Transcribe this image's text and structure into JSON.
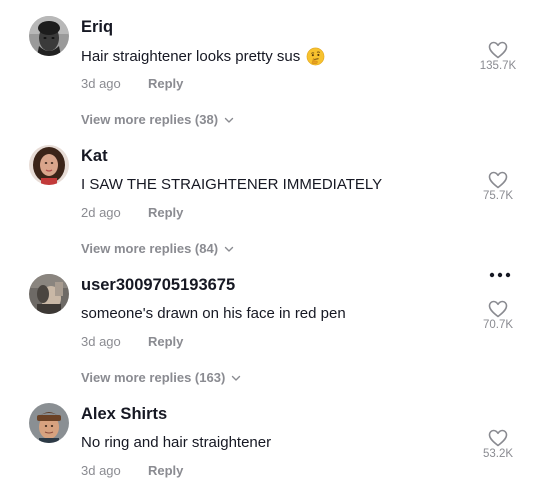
{
  "comments": [
    {
      "username": "Eriq",
      "text": "Hair straightener looks pretty sus",
      "emoji": "thinking-face-emoji",
      "age": "3d ago",
      "reply_label": "Reply",
      "likes": "135.7K",
      "view_more": "View more replies (38)"
    },
    {
      "username": "Kat",
      "text": "I SAW THE STRAIGHTENER IMMEDIATELY",
      "age": "2d ago",
      "reply_label": "Reply",
      "likes": "75.7K",
      "view_more": "View more replies (84)"
    },
    {
      "username": "user3009705193675",
      "text": "someone's drawn on his face in red pen",
      "age": "3d ago",
      "reply_label": "Reply",
      "likes": "70.7K",
      "view_more": "View more replies (163)",
      "more_icon": "ellipsis-icon"
    },
    {
      "username": "Alex Shirts",
      "text": "No ring and hair straightener",
      "age": "3d ago",
      "reply_label": "Reply",
      "likes": "53.2K"
    }
  ],
  "icons": {
    "like": "heart-outline-icon",
    "expand": "chevron-down-icon"
  },
  "colors": {
    "primary_text": "#161823",
    "secondary_text": "#8a8b91"
  }
}
